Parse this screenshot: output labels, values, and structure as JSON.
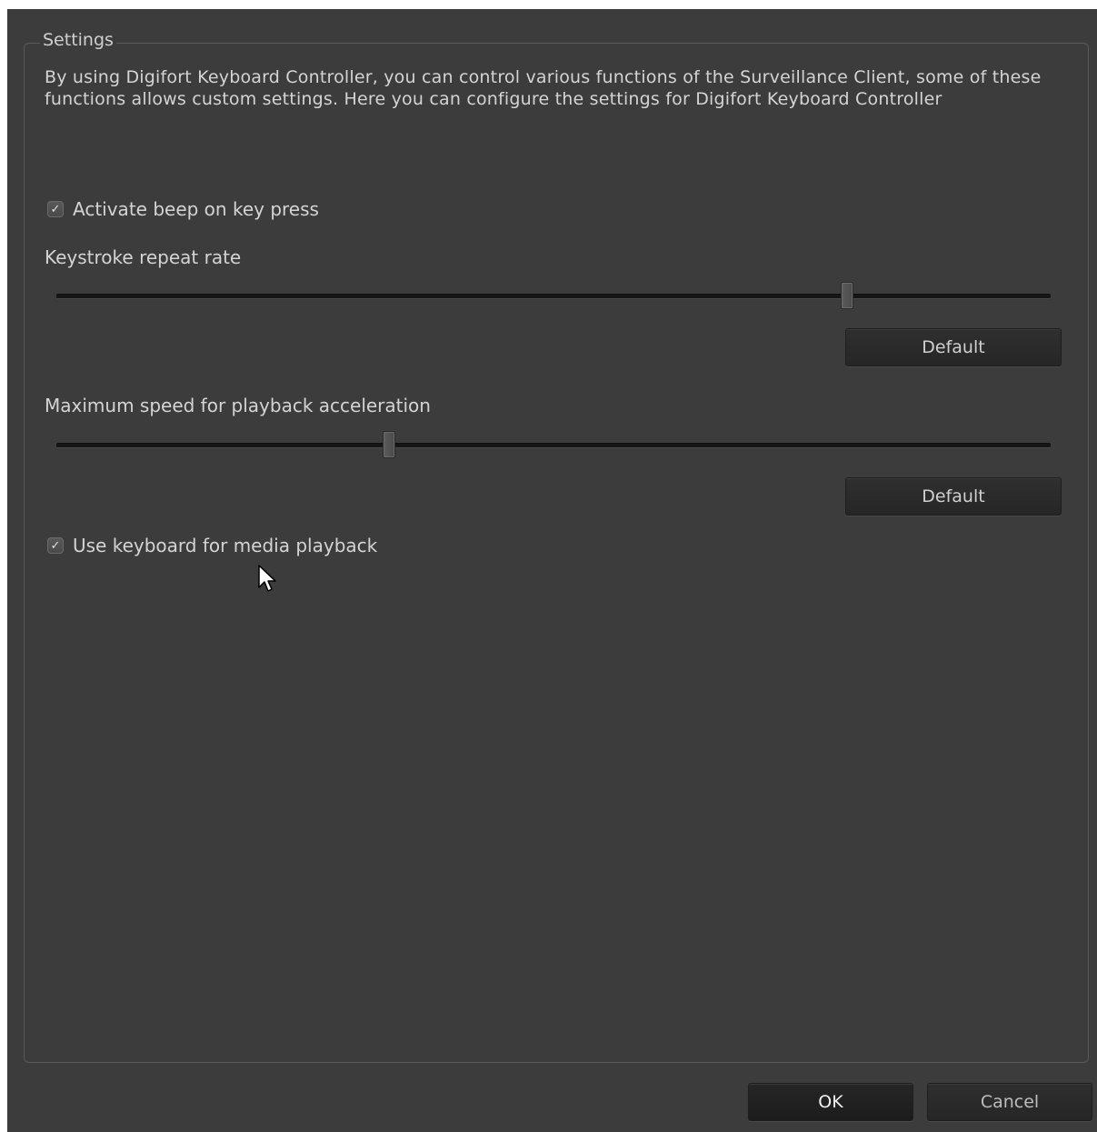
{
  "settings": {
    "group_title": "Settings",
    "description": "By using Digifort Keyboard Controller, you can control various functions of the Surveillance Client, some of these functions allows custom settings. Here you can configure the settings for Digifort Keyboard Controller",
    "beep_checkbox": {
      "label": "Activate beep on key press",
      "checked": true
    },
    "keystroke_rate": {
      "label": "Keystroke repeat rate",
      "value_fraction": 0.795,
      "default_label": "Default"
    },
    "playback_speed": {
      "label": "Maximum speed for playback acceleration",
      "value_fraction": 0.335,
      "default_label": "Default"
    },
    "media_checkbox": {
      "label": "Use keyboard for media playback",
      "checked": true
    }
  },
  "footer": {
    "ok_label": "OK",
    "cancel_label": "Cancel"
  },
  "icons": {
    "check": "checkmark-icon",
    "cursor": "mouse-pointer-icon"
  },
  "colors": {
    "background": "#3c3c3c",
    "text": "#d4d4d4",
    "button": "#2a2a2a"
  }
}
